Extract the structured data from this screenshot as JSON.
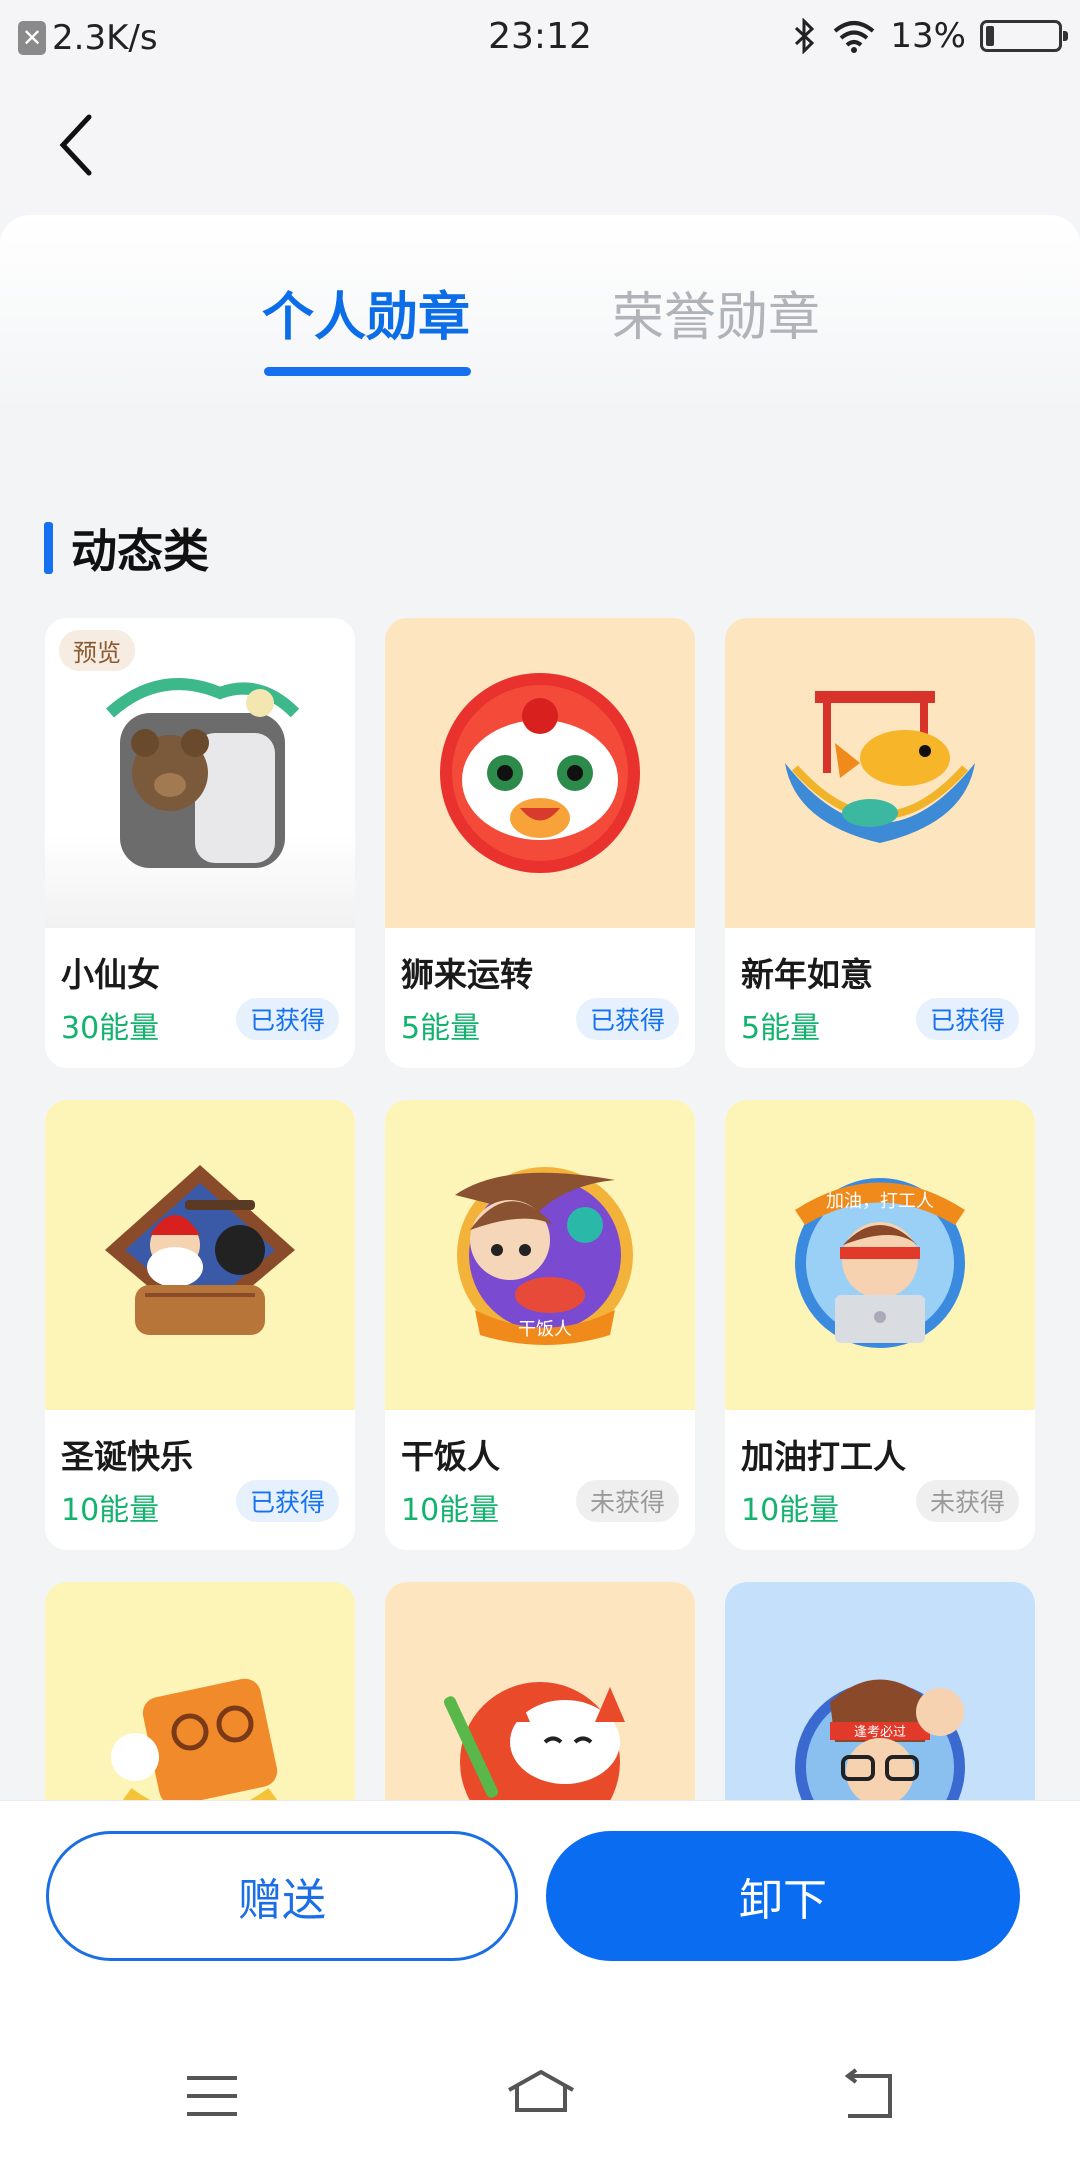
{
  "status_bar": {
    "speed": "2.3K/s",
    "time": "23:12",
    "battery": "13%"
  },
  "tabs": {
    "personal": "个人勋章",
    "honor": "荣誉勋章"
  },
  "section": {
    "title": "动态类"
  },
  "preview_label": "预览",
  "cards": [
    {
      "name": "小仙女",
      "energy": "30能量",
      "status": "已获得"
    },
    {
      "name": "狮来运转",
      "energy": "5能量",
      "status": "已获得"
    },
    {
      "name": "新年如意",
      "energy": "5能量",
      "status": "已获得"
    },
    {
      "name": "圣诞快乐",
      "energy": "10能量",
      "status": "已获得"
    },
    {
      "name": "干饭人",
      "energy": "10能量",
      "status": "未获得"
    },
    {
      "name": "加油打工人",
      "energy": "10能量",
      "status": "未获得"
    }
  ],
  "badge_texts": {
    "gan_fan": "干饭人",
    "da_gong": "加油，打工人",
    "kao_shi": "逢考必过"
  },
  "buttons": {
    "gift": "赠送",
    "remove": "卸下"
  },
  "colors": {
    "accent": "#0b6ee8",
    "energy": "#13b36f"
  }
}
